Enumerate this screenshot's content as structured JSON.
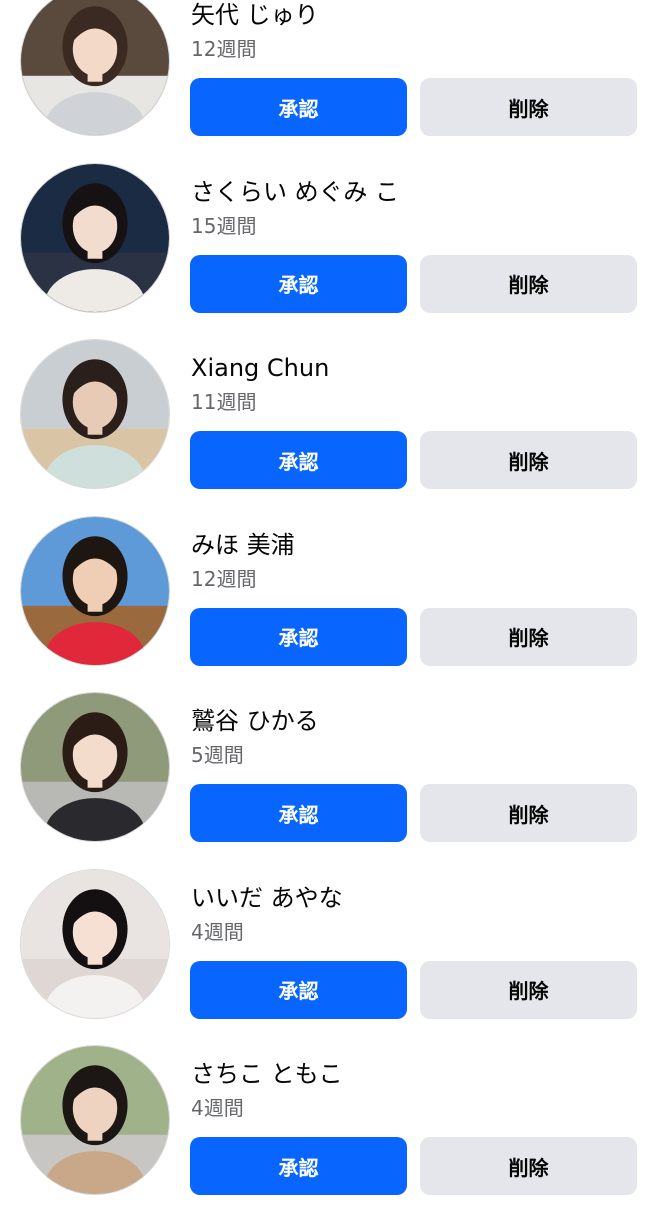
{
  "friend_requests": [
    {
      "name": "矢代 じゅり",
      "time": "12週間",
      "confirm_label": "承認",
      "delete_label": "削除",
      "avatar": {
        "sky": "#5a4a3e",
        "ground": "#e8e6e2",
        "skin": "#f3d9c8",
        "hair": "#3a2a22",
        "clothes": "#cfd2d6"
      }
    },
    {
      "name": "さくらい めぐみ こ",
      "time": "15週間",
      "confirm_label": "承認",
      "delete_label": "削除",
      "avatar": {
        "sky": "#1b2b44",
        "ground": "#2a3244",
        "skin": "#f2dccd",
        "hair": "#161214",
        "clothes": "#eeeae6"
      }
    },
    {
      "name": "Xiang Chun",
      "time": "11週間",
      "confirm_label": "承認",
      "delete_label": "削除",
      "avatar": {
        "sky": "#c9ced2",
        "ground": "#d9c4a6",
        "skin": "#e8cbb6",
        "hair": "#2a1f1a",
        "clothes": "#cfe0dc"
      }
    },
    {
      "name": "みほ 美浦",
      "time": "12週間",
      "confirm_label": "承認",
      "delete_label": "削除",
      "avatar": {
        "sky": "#5f9ad8",
        "ground": "#9a6a3e",
        "skin": "#f0cdb5",
        "hair": "#1e1610",
        "clothes": "#e0283a"
      }
    },
    {
      "name": "鷲谷 ひかる",
      "time": "5週間",
      "confirm_label": "承認",
      "delete_label": "削除",
      "avatar": {
        "sky": "#8f9a7a",
        "ground": "#b8b8b4",
        "skin": "#f4dccd",
        "hair": "#2b1c16",
        "clothes": "#2a2a2e"
      }
    },
    {
      "name": "いいだ あやな",
      "time": "4週間",
      "confirm_label": "承認",
      "delete_label": "削除",
      "avatar": {
        "sky": "#e9e4e2",
        "ground": "#ded7d4",
        "skin": "#f6e0d4",
        "hair": "#141012",
        "clothes": "#f4f2f0"
      }
    },
    {
      "name": "さちこ ともこ",
      "time": "4週間",
      "confirm_label": "承認",
      "delete_label": "削除",
      "avatar": {
        "sky": "#9fb28a",
        "ground": "#c8c6c2",
        "skin": "#eed3c1",
        "hair": "#1c1614",
        "clothes": "#c9a889"
      }
    }
  ],
  "colors": {
    "confirm_bg": "#0866ff",
    "delete_bg": "#e4e6eb",
    "meta_text": "#65676b"
  }
}
